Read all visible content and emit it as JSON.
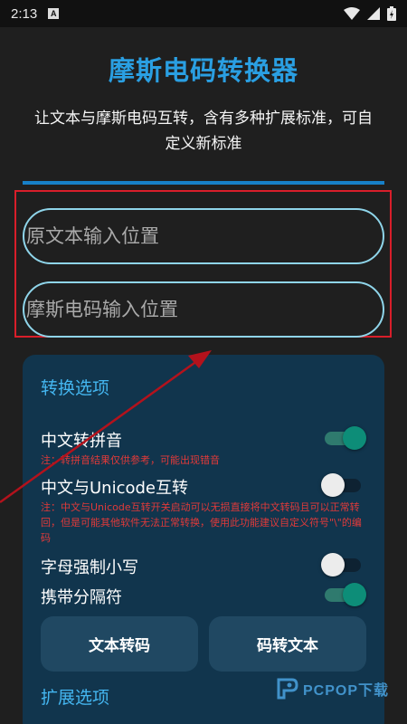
{
  "status_bar": {
    "time": "2:13",
    "notification_letter": "A"
  },
  "app": {
    "title": "摩斯电码转换器",
    "subtitle": "让文本与摩斯电码互转，含有多种扩展标准，可自定义新标准",
    "accent_color": "#2a9fe2"
  },
  "inputs": {
    "original_placeholder": "原文本输入位置",
    "morse_placeholder": "摩斯电码输入位置"
  },
  "conversion_options": {
    "heading": "转换选项",
    "pinyin": {
      "label": "中文转拼音",
      "note": "注：转拼音结果仅供参考，可能出现错音",
      "enabled": true
    },
    "unicode": {
      "label": "中文与Unicode互转",
      "note": "注：中文与Unicode互转开关启动可以无损直接将中文转码且可以正常转回，但是可能其他软件无法正常转换，使用此功能建议自定义符号\"\\\"的编码",
      "enabled": false
    },
    "lowercase": {
      "label": "字母强制小写",
      "enabled": false
    },
    "separator": {
      "label": "携带分隔符",
      "enabled": true
    }
  },
  "actions": {
    "encode_label": "文本转码",
    "decode_label": "码转文本"
  },
  "extension_options": {
    "heading": "扩展选项"
  },
  "watermark": {
    "text": "PCPOP下载"
  }
}
